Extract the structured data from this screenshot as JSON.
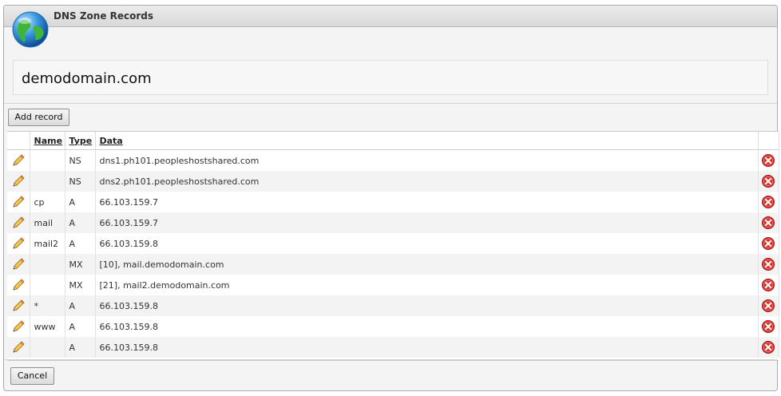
{
  "window": {
    "title": "DNS Zone Records"
  },
  "zone": {
    "domain": "demodomain.com"
  },
  "toolbar": {
    "add_label": "Add record"
  },
  "footer": {
    "cancel_label": "Cancel"
  },
  "table": {
    "headers": {
      "name": "Name",
      "type": "Type",
      "data": "Data"
    },
    "rows": [
      {
        "name": "",
        "type": "NS",
        "data": "dns1.ph101.peopleshostshared.com"
      },
      {
        "name": "",
        "type": "NS",
        "data": "dns2.ph101.peopleshostshared.com"
      },
      {
        "name": "cp",
        "type": "A",
        "data": "66.103.159.7"
      },
      {
        "name": "mail",
        "type": "A",
        "data": "66.103.159.7"
      },
      {
        "name": "mail2",
        "type": "A",
        "data": "66.103.159.8"
      },
      {
        "name": "",
        "type": "MX",
        "data": "[10], mail.demodomain.com"
      },
      {
        "name": "",
        "type": "MX",
        "data": "[21], mail2.demodomain.com"
      },
      {
        "name": "*",
        "type": "A",
        "data": "66.103.159.8"
      },
      {
        "name": "www",
        "type": "A",
        "data": "66.103.159.8"
      },
      {
        "name": "",
        "type": "A",
        "data": "66.103.159.8"
      }
    ]
  },
  "icons": {
    "logo": "globe-icon",
    "edit": "pencil-icon",
    "delete": "delete-icon"
  },
  "colors": {
    "delete": "#d9302c",
    "header_bg": "#dcdcdc"
  }
}
